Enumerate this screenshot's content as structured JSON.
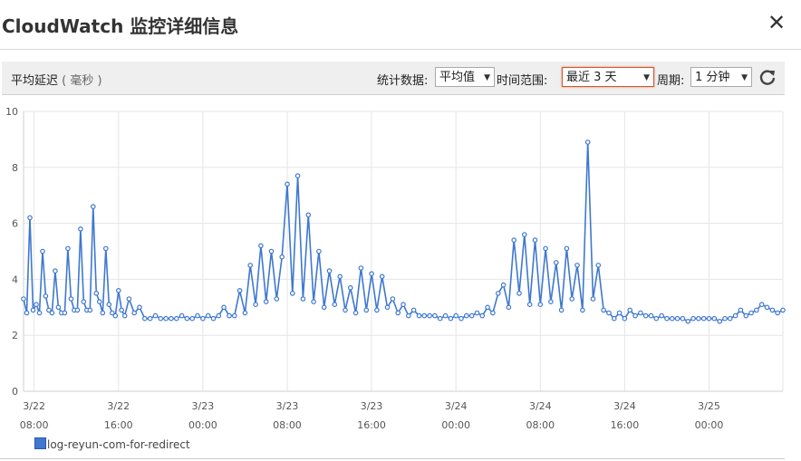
{
  "window": {
    "title": "CloudWatch 监控详细信息",
    "close_label": "✕"
  },
  "toolbar": {
    "metric_name": "平均延迟",
    "metric_unit": "( 毫秒 )",
    "stat_label": "统计数据:",
    "stat_value": "平均值",
    "range_label": "时间范围:",
    "range_value": "最近 3 天",
    "period_label": "周期:",
    "period_value": "1 分钟",
    "refresh_icon": "refresh-icon"
  },
  "legend": {
    "series_label": "log-reyun-com-for-redirect"
  },
  "colors": {
    "series": "#3f78d0",
    "grid": "#e5e5e5",
    "active_select_border": "#d0582c"
  },
  "chart_data": {
    "type": "line",
    "ylim": [
      0,
      10
    ],
    "yticks": [
      0,
      2,
      4,
      6,
      8,
      10
    ],
    "grid": true,
    "legend_position": "bottom-left",
    "xticks": [
      {
        "date": "3/22",
        "time": "08:00"
      },
      {
        "date": "3/22",
        "time": "16:00"
      },
      {
        "date": "3/23",
        "time": "00:00"
      },
      {
        "date": "3/23",
        "time": "08:00"
      },
      {
        "date": "3/23",
        "time": "16:00"
      },
      {
        "date": "3/24",
        "time": "00:00"
      },
      {
        "date": "3/24",
        "time": "08:00"
      },
      {
        "date": "3/24",
        "time": "16:00"
      },
      {
        "date": "3/25",
        "time": "00:00"
      }
    ],
    "xlim_hours": [
      0,
      72
    ],
    "series": [
      {
        "name": "log-reyun-com-for-redirect",
        "x_hours": [
          0,
          0.3,
          0.6,
          0.9,
          1.2,
          1.5,
          1.8,
          2.1,
          2.4,
          2.7,
          3.0,
          3.3,
          3.6,
          3.9,
          4.2,
          4.5,
          4.8,
          5.1,
          5.4,
          5.7,
          6.0,
          6.3,
          6.6,
          6.9,
          7.2,
          7.5,
          7.8,
          8.1,
          8.4,
          8.7,
          9.0,
          9.3,
          9.6,
          10.0,
          10.5,
          11.0,
          11.5,
          12.0,
          12.5,
          13.0,
          13.5,
          14.0,
          14.5,
          15.0,
          15.5,
          16.0,
          16.5,
          17.0,
          17.5,
          18.0,
          18.5,
          19.0,
          19.5,
          20.0,
          20.5,
          21.0,
          21.5,
          22.0,
          22.5,
          23.0,
          23.5,
          24.0,
          24.5,
          25.0,
          25.5,
          26.0,
          26.5,
          27.0,
          27.5,
          28.0,
          28.5,
          29.0,
          29.5,
          30.0,
          30.5,
          31.0,
          31.5,
          32.0,
          32.5,
          33.0,
          33.5,
          34.0,
          34.5,
          35.0,
          35.5,
          36.0,
          36.5,
          37.0,
          37.5,
          38.0,
          38.5,
          39.0,
          39.5,
          40.0,
          40.5,
          41.0,
          41.5,
          42.0,
          42.5,
          43.0,
          43.5,
          44.0,
          44.5,
          45.0,
          45.5,
          46.0,
          46.5,
          47.0,
          47.5,
          48.0,
          48.5,
          49.0,
          49.5,
          50.0,
          50.5,
          51.0,
          51.5,
          52.0,
          52.5,
          53.0,
          53.5,
          54.0,
          54.5,
          55.0,
          55.5,
          56.0,
          56.5,
          57.0,
          57.5,
          58.0,
          58.5,
          59.0,
          59.5,
          60.0,
          60.5,
          61.0,
          61.5,
          62.0,
          62.5,
          63.0,
          63.5,
          64.0,
          64.5,
          65.0,
          65.5,
          66.0,
          66.5,
          67.0,
          67.5,
          68.0,
          68.5,
          69.0,
          69.5,
          70.0,
          70.5,
          71.0,
          71.5,
          72.0
        ],
        "values": [
          3.3,
          2.8,
          6.2,
          2.9,
          3.1,
          2.8,
          5.0,
          3.4,
          2.9,
          2.8,
          4.3,
          3.0,
          2.8,
          2.8,
          5.1,
          3.3,
          2.9,
          2.9,
          5.8,
          3.2,
          2.9,
          2.9,
          6.6,
          3.5,
          3.2,
          2.8,
          5.1,
          3.1,
          2.8,
          2.7,
          3.6,
          2.9,
          2.7,
          3.3,
          2.8,
          3.0,
          2.6,
          2.6,
          2.7,
          2.6,
          2.6,
          2.6,
          2.6,
          2.7,
          2.6,
          2.6,
          2.7,
          2.6,
          2.7,
          2.6,
          2.7,
          3.0,
          2.7,
          2.7,
          3.6,
          2.8,
          4.5,
          3.1,
          5.2,
          3.2,
          5.0,
          3.3,
          4.8,
          7.4,
          3.5,
          7.7,
          3.3,
          6.3,
          3.2,
          5.0,
          3.0,
          4.3,
          3.1,
          4.1,
          2.9,
          3.7,
          2.8,
          4.4,
          2.9,
          4.2,
          2.9,
          4.1,
          3.0,
          3.3,
          2.8,
          3.1,
          2.7,
          2.9,
          2.7,
          2.7,
          2.7,
          2.7,
          2.6,
          2.7,
          2.6,
          2.7,
          2.6,
          2.7,
          2.7,
          2.8,
          2.7,
          3.0,
          2.8,
          3.5,
          3.8,
          3.0,
          5.4,
          3.5,
          5.6,
          3.1,
          5.4,
          3.1,
          5.1,
          3.2,
          4.6,
          2.9,
          5.1,
          3.3,
          4.5,
          2.9,
          8.9,
          3.3,
          4.5,
          2.9,
          2.8,
          2.6,
          2.8,
          2.6,
          2.9,
          2.7,
          2.8,
          2.7,
          2.7,
          2.6,
          2.7,
          2.6,
          2.6,
          2.6,
          2.6,
          2.5,
          2.6,
          2.6,
          2.6,
          2.6,
          2.6,
          2.5,
          2.6,
          2.6,
          2.7,
          2.9,
          2.7,
          2.8,
          2.9,
          3.1,
          3.0,
          2.9,
          2.8,
          2.9,
          2.6
        ]
      }
    ]
  }
}
